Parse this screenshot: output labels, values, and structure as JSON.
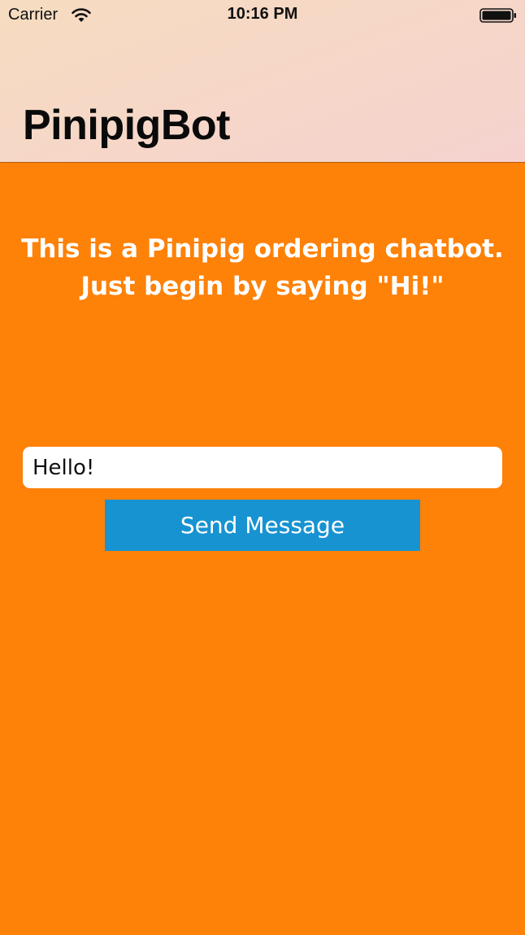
{
  "status_bar": {
    "carrier": "Carrier",
    "time": "10:16 PM",
    "wifi_icon": "wifi-icon",
    "battery_icon": "battery-full-icon"
  },
  "nav": {
    "title": "PinipigBot"
  },
  "main": {
    "intro_line1": "This is a Pinipig ordering chatbot.",
    "intro_line2": "Just begin by saying \"Hi!\"",
    "message_input_value": "Hello!",
    "send_button_label": "Send Message"
  },
  "colors": {
    "background": "#fe8108",
    "button": "#1793d1",
    "header_gradient_start": "#f6dcc0",
    "header_gradient_end": "#f5d2cf"
  }
}
